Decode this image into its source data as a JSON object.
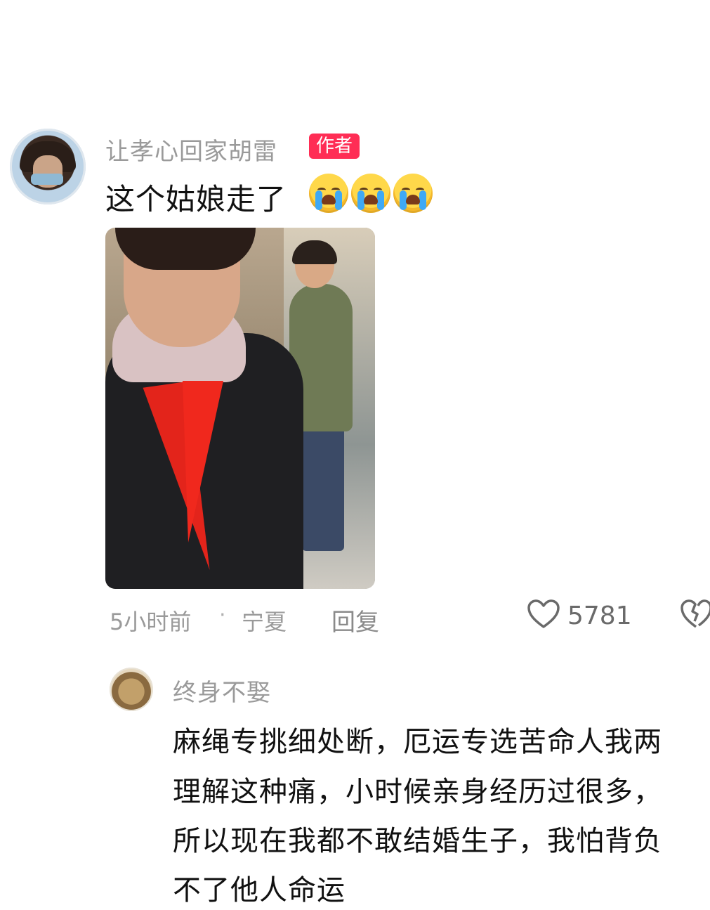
{
  "comment": {
    "username": "让孝心回家胡雷",
    "badge": "作者",
    "text": "这个姑娘走了",
    "emojis": [
      "crying-face",
      "crying-face",
      "crying-face"
    ],
    "time": "5小时前",
    "separator": "·",
    "location": "宁夏",
    "reply_label": "回复",
    "likes": "5781"
  },
  "reply": {
    "username": "终身不娶",
    "lines": [
      "麻绳专挑细处断，厄运专选苦命人我两",
      "理解这种痛，小时候亲身经历过很多，",
      "所以现在我都不敢结婚生子，我怕背负",
      "不了他人命运"
    ]
  },
  "colors": {
    "badge": "#ff2d55",
    "meta_text": "#9a9a9a",
    "body_text": "#111111"
  }
}
